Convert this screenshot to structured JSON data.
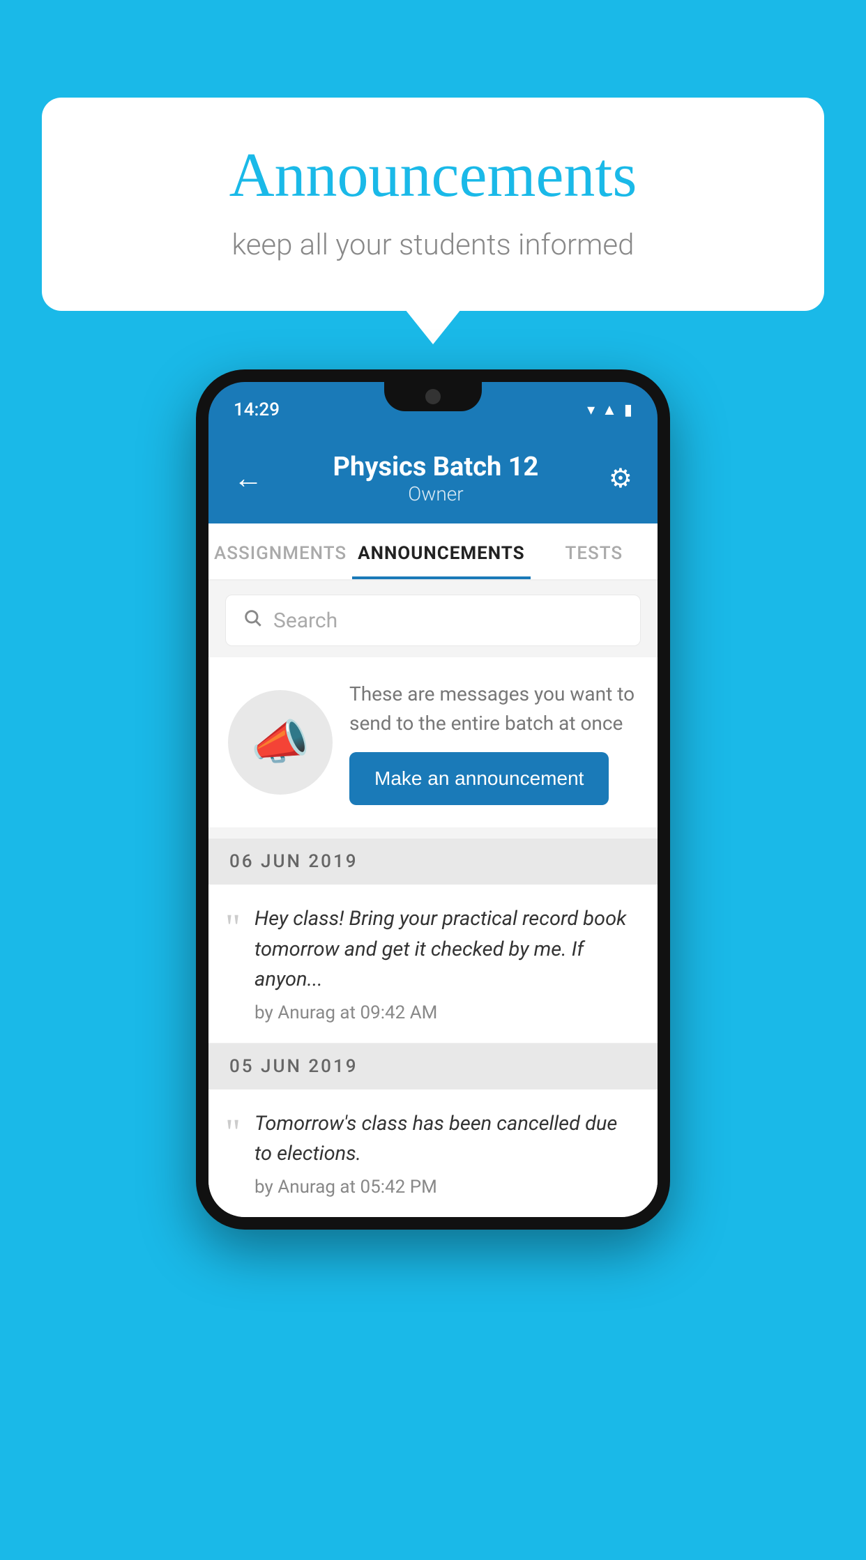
{
  "background_color": "#1ab9e8",
  "speech_bubble": {
    "title": "Announcements",
    "subtitle": "keep all your students informed"
  },
  "phone": {
    "status_bar": {
      "time": "14:29"
    },
    "header": {
      "title": "Physics Batch 12",
      "subtitle": "Owner",
      "back_label": "←",
      "gear_label": "⚙"
    },
    "tabs": [
      {
        "label": "ASSIGNMENTS",
        "active": false
      },
      {
        "label": "ANNOUNCEMENTS",
        "active": true
      },
      {
        "label": "TESTS",
        "active": false
      }
    ],
    "search": {
      "placeholder": "Search"
    },
    "promo": {
      "description": "These are messages you want to send to the entire batch at once",
      "button_label": "Make an announcement"
    },
    "announcements": [
      {
        "date": "06  JUN  2019",
        "text": "Hey class! Bring your practical record book tomorrow and get it checked by me. If anyon...",
        "meta": "by Anurag at 09:42 AM"
      },
      {
        "date": "05  JUN  2019",
        "text": "Tomorrow's class has been cancelled due to elections.",
        "meta": "by Anurag at 05:42 PM"
      }
    ]
  }
}
